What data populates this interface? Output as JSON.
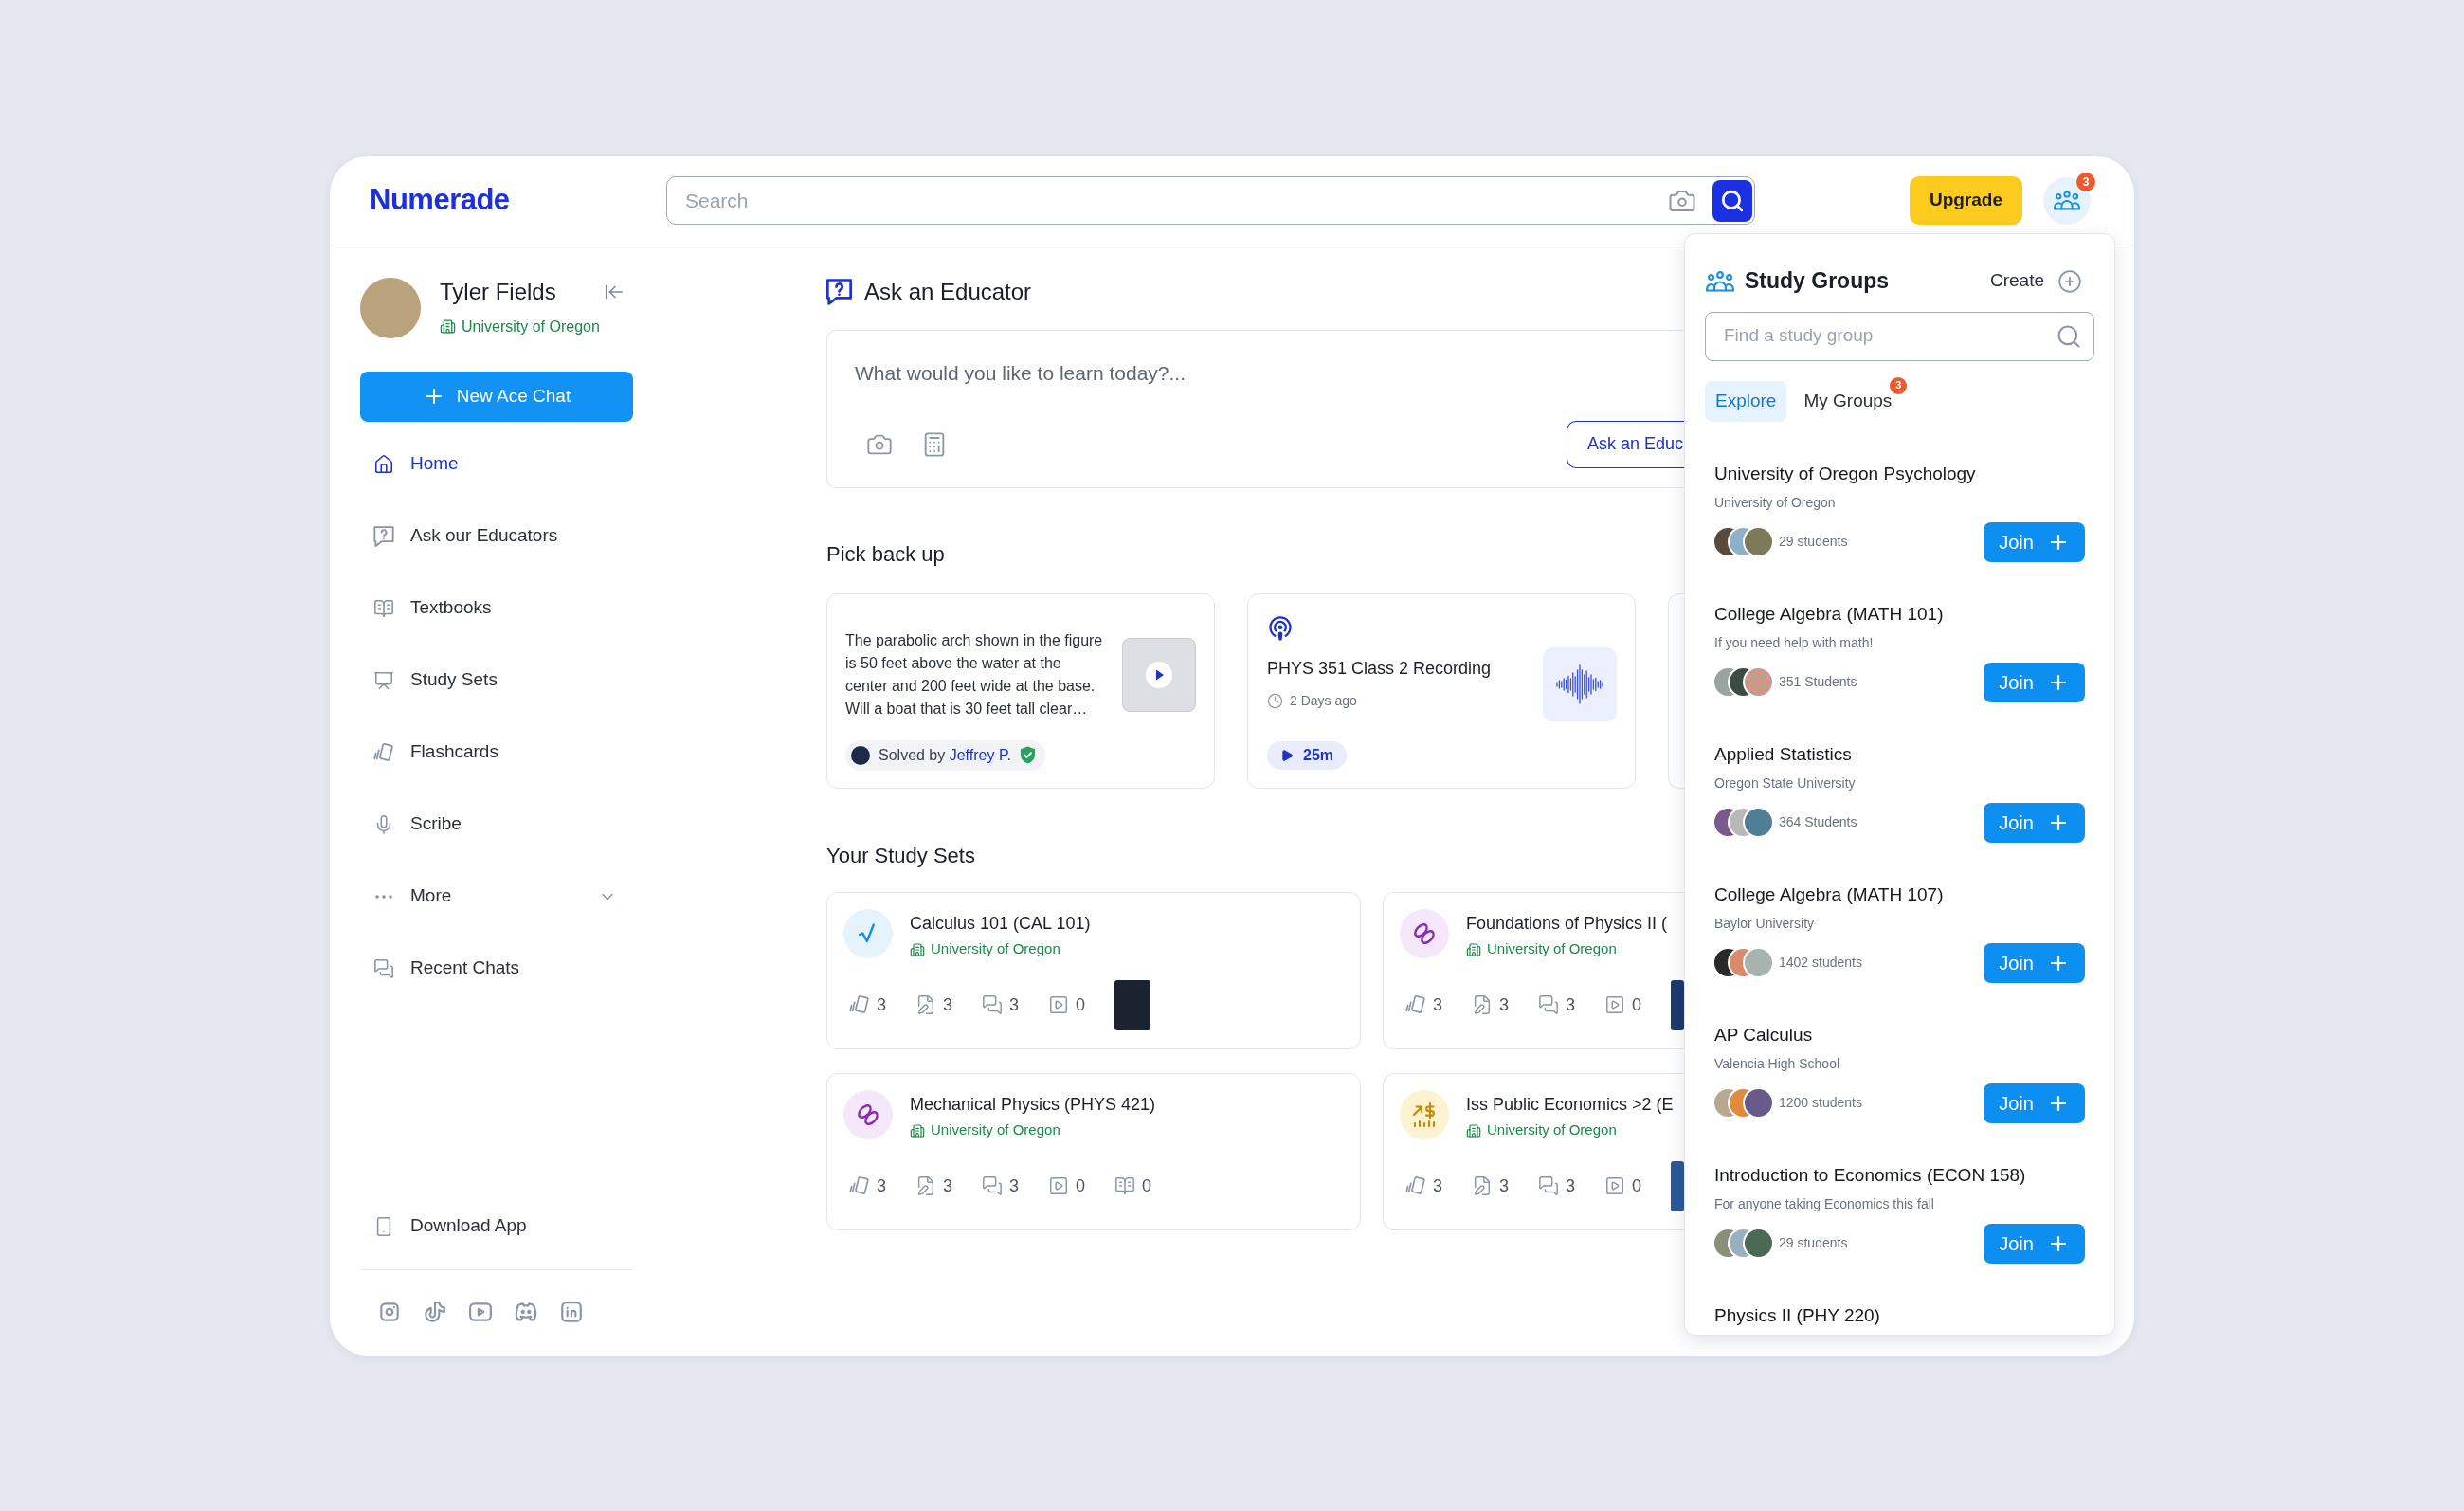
{
  "header": {
    "logo": "Numerade",
    "search": {
      "placeholder": "Search"
    },
    "upgrade_button": "Upgrade",
    "groups_badge": "3"
  },
  "sidebar": {
    "user": {
      "name": "Tyler Fields",
      "school": "University of Oregon"
    },
    "new_chat_button": "New Ace Chat",
    "items": [
      {
        "label": "Home",
        "kind": "link",
        "selected": true
      },
      {
        "label": "Ask our Educators",
        "kind": "link",
        "selected": false
      },
      {
        "label": "Textbooks",
        "kind": "link",
        "selected": false
      },
      {
        "label": "Study Sets",
        "kind": "link",
        "selected": false
      },
      {
        "label": "Flashcards",
        "kind": "link",
        "selected": false
      },
      {
        "label": "Scribe",
        "kind": "link",
        "selected": false
      },
      {
        "label": "More",
        "kind": "dropdown",
        "selected": false
      },
      {
        "label": "Recent Chats",
        "kind": "link",
        "selected": false
      }
    ],
    "download_app": "Download App"
  },
  "ask_educator": {
    "title": "Ask an Educator",
    "input": {
      "placeholder": "What would you like to learn today?..."
    },
    "submit_button": "Ask an Educ"
  },
  "pick_back_up": {
    "title": "Pick back up",
    "cards": [
      {
        "kind": "question",
        "text": "The parabolic arch shown in the figure is 50 feet above the water at the center and 200 feet wide at the base. Will a boat that is 30 feet tall clear…",
        "solved_by": "Solved by",
        "solver": "Jeffrey P."
      },
      {
        "kind": "recording",
        "title": "PHYS 351 Class 2 Recording",
        "time": "2 Days ago",
        "duration": "25m"
      }
    ]
  },
  "study_sets": {
    "title": "Your Study Sets",
    "sets": [
      {
        "title": "Calculus 101 (CAL 101)",
        "school": "University of Oregon",
        "stats": [
          {
            "kind": "flashcards",
            "value": "3"
          },
          {
            "kind": "notes",
            "value": "3"
          },
          {
            "kind": "chats",
            "value": "3"
          },
          {
            "kind": "videos",
            "value": "0"
          }
        ],
        "cover": true
      },
      {
        "title": "Foundations of Physics II (",
        "school": "University of Oregon",
        "stats": [
          {
            "kind": "flashcards",
            "value": "3"
          },
          {
            "kind": "notes",
            "value": "3"
          },
          {
            "kind": "chats",
            "value": "3"
          },
          {
            "kind": "videos",
            "value": "0"
          }
        ],
        "cover": true
      },
      {
        "title": "Mechanical Physics (PHYS 421)",
        "school": "University of Oregon",
        "stats": [
          {
            "kind": "flashcards",
            "value": "3"
          },
          {
            "kind": "notes",
            "value": "3"
          },
          {
            "kind": "chats",
            "value": "3"
          },
          {
            "kind": "videos",
            "value": "0"
          },
          {
            "kind": "textbooks",
            "value": "0"
          }
        ],
        "cover": false
      },
      {
        "title": "Iss Public Economics >2 (E",
        "school": "University of Oregon",
        "stats": [
          {
            "kind": "flashcards",
            "value": "3"
          },
          {
            "kind": "notes",
            "value": "3"
          },
          {
            "kind": "chats",
            "value": "3"
          },
          {
            "kind": "videos",
            "value": "0"
          }
        ],
        "cover": true
      }
    ]
  },
  "study_groups": {
    "title": "Study Groups",
    "create_button": "Create",
    "search": {
      "placeholder": "Find a study group"
    },
    "tabs": [
      {
        "label": "Explore",
        "selected": true
      },
      {
        "label": "My Groups",
        "selected": false,
        "badge": "3"
      }
    ],
    "groups": [
      {
        "name": "University of Oregon Psychology",
        "subtitle": "University of Oregon",
        "members": "29 students",
        "join_button": "Join"
      },
      {
        "name": "College Algebra (MATH 101)",
        "subtitle": "If you need help with math!",
        "members": "351 Students",
        "join_button": "Join"
      },
      {
        "name": "Applied Statistics",
        "subtitle": "Oregon State University",
        "members": "364 Students",
        "join_button": "Join"
      },
      {
        "name": "College Algebra (MATH 107)",
        "subtitle": "Baylor University",
        "members": "1402 students",
        "join_button": "Join"
      },
      {
        "name": "AP Calculus",
        "subtitle": "Valencia High School",
        "members": "1200 students",
        "join_button": "Join"
      },
      {
        "name": "Introduction to Economics (ECON 158)",
        "subtitle": "For anyone taking Economics this fall",
        "members": "29 students",
        "join_button": "Join"
      },
      {
        "name": "Physics II (PHY 220)"
      }
    ]
  }
}
